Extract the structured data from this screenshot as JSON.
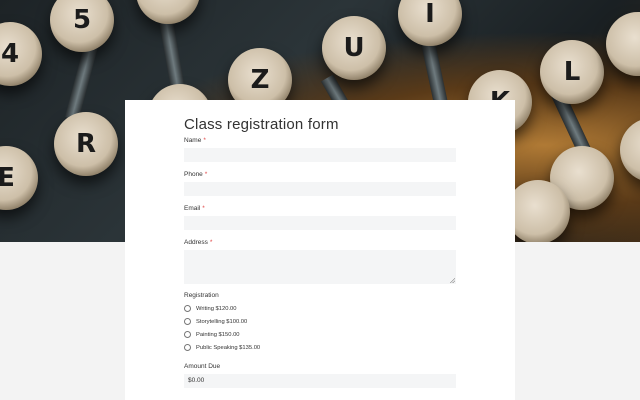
{
  "hero": {
    "keys": [
      "4",
      "5",
      "U",
      "I",
      "Z",
      "R",
      "K",
      "L",
      "E",
      "L"
    ],
    "key_symbol_5": "5"
  },
  "form": {
    "title": "Class registration form",
    "required_mark": "*",
    "fields": {
      "name_label": "Name",
      "phone_label": "Phone",
      "email_label": "Email",
      "address_label": "Address"
    },
    "registration": {
      "label": "Registration",
      "options": [
        "Writing $120.00",
        "Storytelling $100.00",
        "Painting $150.00",
        "Public Speaking $135.00"
      ]
    },
    "amount": {
      "label": "Amount Due",
      "value": "$0.00"
    }
  }
}
